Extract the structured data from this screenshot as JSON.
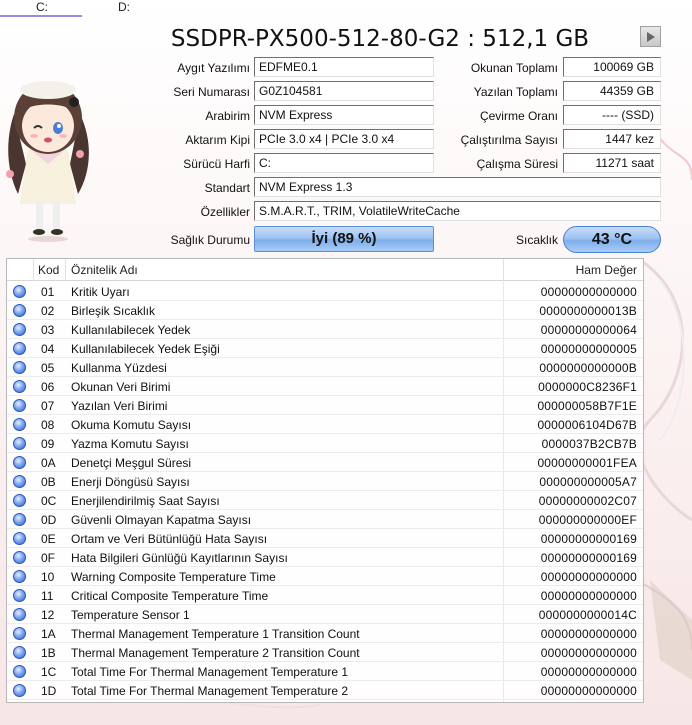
{
  "tabs": [
    {
      "label": "C:"
    },
    {
      "label": "D:"
    }
  ],
  "drive": {
    "title": "SSDPR-PX500-512-80-G2 : 512,1 GB"
  },
  "info": {
    "firmware_label": "Aygıt Yazılımı",
    "firmware": "EDFME0.1",
    "serial_label": "Seri Numarası",
    "serial": "G0Z104581",
    "interface_label": "Arabirim",
    "interface": "NVM Express",
    "transfer_label": "Aktarım Kipi",
    "transfer": "PCIe 3.0 x4 | PCIe 3.0 x4",
    "letter_label": "Sürücü Harfi",
    "letter": "C:",
    "standard_label": "Standart",
    "standard": "NVM Express 1.3",
    "features_label": "Özellikler",
    "features": "S.M.A.R.T., TRIM, VolatileWriteCache",
    "reads_label": "Okunan Toplamı",
    "reads": "100069 GB",
    "writes_label": "Yazılan Toplamı",
    "writes": "44359 GB",
    "rotation_label": "Çevirme Oranı",
    "rotation": "---- (SSD)",
    "power_count_label": "Çalıştırılma Sayısı",
    "power_count": "1447 kez",
    "power_hours_label": "Çalışma Süresi",
    "power_hours": "11271 saat"
  },
  "health": {
    "label": "Sağlık Durumu",
    "value": "İyi  (89 %)",
    "temp_label": "Sıcaklık",
    "temp": "43 °C",
    "color": "#9fc3f2"
  },
  "table": {
    "headers": {
      "code": "Kod",
      "name": "Öznitelik Adı",
      "raw": "Ham Değer"
    },
    "rows": [
      {
        "code": "01",
        "name": "Kritik Uyarı",
        "raw": "00000000000000"
      },
      {
        "code": "02",
        "name": "Birleşik Sıcaklık",
        "raw": "0000000000013B"
      },
      {
        "code": "03",
        "name": "Kullanılabilecek Yedek",
        "raw": "00000000000064"
      },
      {
        "code": "04",
        "name": "Kullanılabilecek Yedek Eşiği",
        "raw": "00000000000005"
      },
      {
        "code": "05",
        "name": "Kullanma Yüzdesi",
        "raw": "0000000000000B"
      },
      {
        "code": "06",
        "name": "Okunan Veri Birimi",
        "raw": "0000000C8236F1"
      },
      {
        "code": "07",
        "name": "Yazılan Veri Birimi",
        "raw": "000000058B7F1E"
      },
      {
        "code": "08",
        "name": "Okuma Komutu Sayısı",
        "raw": "0000006104D67B"
      },
      {
        "code": "09",
        "name": "Yazma Komutu Sayısı",
        "raw": "0000037B2CB7B"
      },
      {
        "code": "0A",
        "name": "Denetçi Meşgul Süresi",
        "raw": "00000000001FEA"
      },
      {
        "code": "0B",
        "name": "Enerji Döngüsü Sayısı",
        "raw": "000000000005A7"
      },
      {
        "code": "0C",
        "name": "Enerjilendirilmiş Saat Sayısı",
        "raw": "00000000002C07"
      },
      {
        "code": "0D",
        "name": "Güvenli Olmayan Kapatma Sayısı",
        "raw": "000000000000EF"
      },
      {
        "code": "0E",
        "name": "Ortam ve Veri Bütünlüğü Hata Sayısı",
        "raw": "00000000000169"
      },
      {
        "code": "0F",
        "name": "Hata Bilgileri Günlüğü Kayıtlarının Sayısı",
        "raw": "00000000000169"
      },
      {
        "code": "10",
        "name": "Warning Composite Temperature Time",
        "raw": "00000000000000"
      },
      {
        "code": "11",
        "name": "Critical Composite Temperature Time",
        "raw": "00000000000000"
      },
      {
        "code": "12",
        "name": "Temperature Sensor 1",
        "raw": "0000000000014C"
      },
      {
        "code": "1A",
        "name": "Thermal Management Temperature 1 Transition Count",
        "raw": "00000000000000"
      },
      {
        "code": "1B",
        "name": "Thermal Management Temperature 2 Transition Count",
        "raw": "00000000000000"
      },
      {
        "code": "1C",
        "name": "Total Time For Thermal Management Temperature 1",
        "raw": "00000000000000"
      },
      {
        "code": "1D",
        "name": "Total Time For Thermal Management Temperature 2",
        "raw": "00000000000000"
      }
    ]
  }
}
